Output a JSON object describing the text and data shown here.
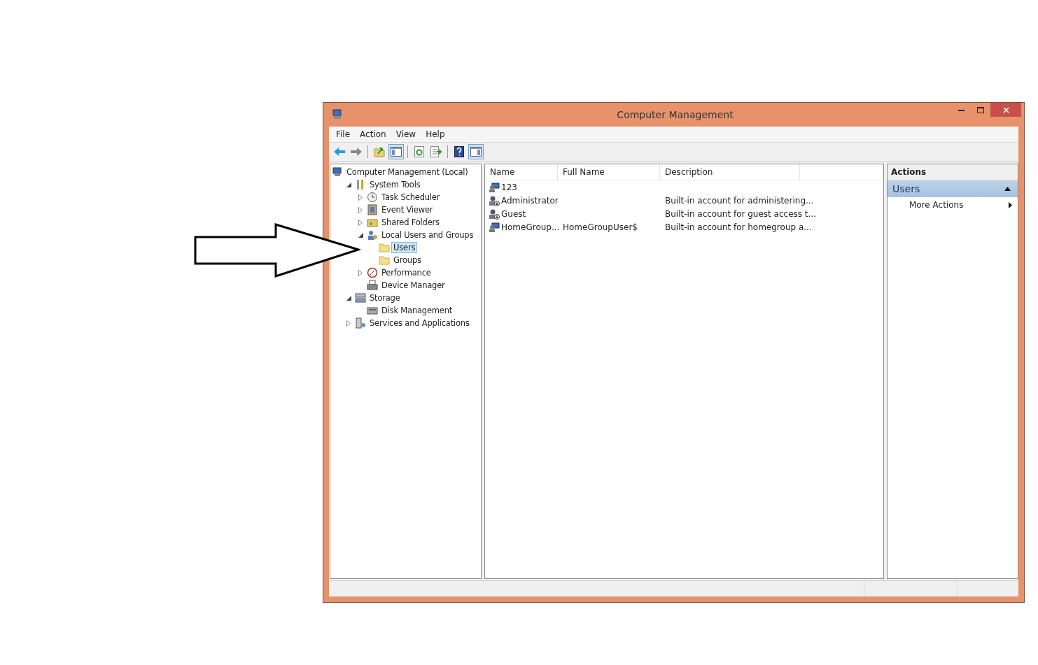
{
  "window": {
    "title": "Computer Management"
  },
  "menu": [
    "File",
    "Action",
    "View",
    "Help"
  ],
  "toolbar": [
    {
      "kind": "back",
      "on": false
    },
    {
      "kind": "forward",
      "on": false
    },
    {
      "kind": "separator"
    },
    {
      "kind": "up",
      "on": false
    },
    {
      "kind": "tree",
      "on": true
    },
    {
      "kind": "separator"
    },
    {
      "kind": "refresh",
      "on": false
    },
    {
      "kind": "export",
      "on": false
    },
    {
      "kind": "separator"
    },
    {
      "kind": "help",
      "on": false
    },
    {
      "kind": "actionpane",
      "on": true
    }
  ],
  "tree": [
    {
      "label": "Computer Management (Local)",
      "kind": "computer",
      "selected": false,
      "children": [
        {
          "label": "System Tools",
          "kind": "tools",
          "expanded": true,
          "selected": false,
          "children": [
            {
              "label": "Task Scheduler",
              "kind": "clock",
              "expanded": false,
              "selected": false
            },
            {
              "label": "Event Viewer",
              "kind": "log",
              "expanded": false,
              "selected": false
            },
            {
              "label": "Shared Folders",
              "kind": "share",
              "expanded": false,
              "selected": false
            },
            {
              "label": "Local Users and Groups",
              "kind": "users",
              "expanded": true,
              "selected": false,
              "children": [
                {
                  "label": "Users",
                  "kind": "folder",
                  "selected": true
                },
                {
                  "label": "Groups",
                  "kind": "folder",
                  "selected": false
                }
              ]
            },
            {
              "label": "Performance",
              "kind": "gauge",
              "expanded": false,
              "selected": false
            },
            {
              "label": "Device Manager",
              "kind": "device",
              "selected": false
            }
          ]
        },
        {
          "label": "Storage",
          "kind": "storage",
          "expanded": true,
          "selected": false,
          "children": [
            {
              "label": "Disk Management",
              "kind": "disk",
              "selected": false
            }
          ]
        },
        {
          "label": "Services and Applications",
          "kind": "services",
          "expanded": false,
          "selected": false
        }
      ]
    }
  ],
  "table": {
    "columns": [
      "Name",
      "Full Name",
      "Description"
    ],
    "rows": [
      {
        "kind": "user",
        "name": "123"
      },
      {
        "kind": "disabled",
        "name": "Administrator",
        "description": "Built-in account for administering..."
      },
      {
        "kind": "disabled",
        "name": "Guest",
        "description": "Built-in account for guest access t..."
      },
      {
        "kind": "user",
        "name": "HomeGroup...",
        "full_name": "HomeGroupUser$",
        "description": "Built-in account for homegroup a..."
      }
    ]
  },
  "actions": {
    "title": "Actions",
    "section": {
      "label": "Users",
      "expanded": true
    },
    "items": [
      "More Actions"
    ]
  }
}
